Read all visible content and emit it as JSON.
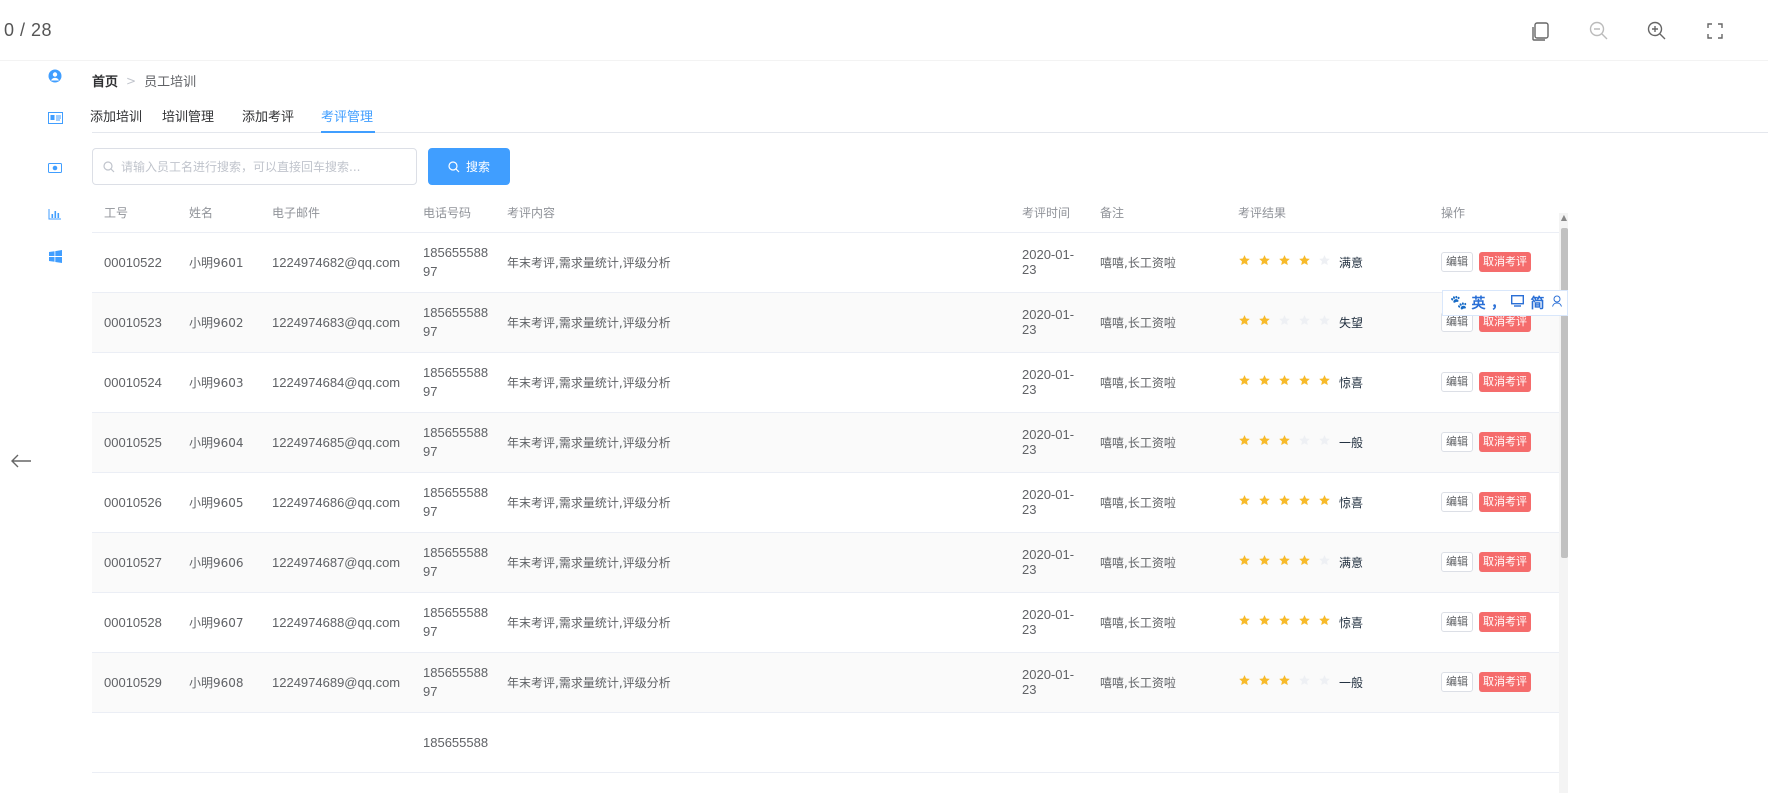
{
  "viewer": {
    "page_counter": "0 / 28",
    "tools": [
      "copy-icon",
      "zoom-out-icon",
      "zoom-in-icon",
      "fullscreen-icon"
    ]
  },
  "colors": {
    "primary": "#409eff",
    "danger": "#f56c6c",
    "star": "#f7ba2a",
    "star_off": "#eef0f4"
  },
  "breadcrumb": {
    "home": "首页",
    "separator": ">",
    "current": "员工培训"
  },
  "tabs": [
    {
      "label": "添加培训",
      "active": false
    },
    {
      "label": "培训管理",
      "active": false
    },
    {
      "label": "添加考评",
      "active": false
    },
    {
      "label": "考评管理",
      "active": true
    }
  ],
  "search": {
    "placeholder": "请输入员工名进行搜索，可以直接回车搜索...",
    "value": "",
    "button_label": "搜索"
  },
  "table": {
    "columns": [
      "工号",
      "姓名",
      "电子邮件",
      "电话号码",
      "考评内容",
      "考评时间",
      "备注",
      "考评结果",
      "操作"
    ],
    "edit_label": "编辑",
    "cancel_label": "取消考评",
    "rows": [
      {
        "id": "00010522",
        "name": "小明9601",
        "email": "1224974682@qq.com",
        "phone_line1": "185655588",
        "phone_line2": "97",
        "content": "年末考评,需求量统计,评级分析",
        "date": "2020-01-23",
        "remark": "嘻嘻,长工资啦",
        "rating": 4,
        "rating_text": "满意"
      },
      {
        "id": "00010523",
        "name": "小明9602",
        "email": "1224974683@qq.com",
        "phone_line1": "185655588",
        "phone_line2": "97",
        "content": "年末考评,需求量统计,评级分析",
        "date": "2020-01-23",
        "remark": "嘻嘻,长工资啦",
        "rating": 2,
        "rating_text": "失望"
      },
      {
        "id": "00010524",
        "name": "小明9603",
        "email": "1224974684@qq.com",
        "phone_line1": "185655588",
        "phone_line2": "97",
        "content": "年末考评,需求量统计,评级分析",
        "date": "2020-01-23",
        "remark": "嘻嘻,长工资啦",
        "rating": 5,
        "rating_text": "惊喜"
      },
      {
        "id": "00010525",
        "name": "小明9604",
        "email": "1224974685@qq.com",
        "phone_line1": "185655588",
        "phone_line2": "97",
        "content": "年末考评,需求量统计,评级分析",
        "date": "2020-01-23",
        "remark": "嘻嘻,长工资啦",
        "rating": 3,
        "rating_text": "一般"
      },
      {
        "id": "00010526",
        "name": "小明9605",
        "email": "1224974686@qq.com",
        "phone_line1": "185655588",
        "phone_line2": "97",
        "content": "年末考评,需求量统计,评级分析",
        "date": "2020-01-23",
        "remark": "嘻嘻,长工资啦",
        "rating": 5,
        "rating_text": "惊喜"
      },
      {
        "id": "00010527",
        "name": "小明9606",
        "email": "1224974687@qq.com",
        "phone_line1": "185655588",
        "phone_line2": "97",
        "content": "年末考评,需求量统计,评级分析",
        "date": "2020-01-23",
        "remark": "嘻嘻,长工资啦",
        "rating": 4,
        "rating_text": "满意"
      },
      {
        "id": "00010528",
        "name": "小明9607",
        "email": "1224974688@qq.com",
        "phone_line1": "185655588",
        "phone_line2": "97",
        "content": "年末考评,需求量统计,评级分析",
        "date": "2020-01-23",
        "remark": "嘻嘻,长工资啦",
        "rating": 5,
        "rating_text": "惊喜"
      },
      {
        "id": "00010529",
        "name": "小明9608",
        "email": "1224974689@qq.com",
        "phone_line1": "185655588",
        "phone_line2": "97",
        "content": "年末考评,需求量统计,评级分析",
        "date": "2020-01-23",
        "remark": "嘻嘻,长工资啦",
        "rating": 3,
        "rating_text": "一般"
      },
      {
        "id": "",
        "name": "",
        "email": "",
        "phone_line1": "185655588",
        "phone_line2": "",
        "content": "",
        "date": "",
        "remark": "",
        "rating": 0,
        "rating_text": ""
      }
    ]
  },
  "ime_toolbar": {
    "items": [
      "英",
      "，",
      "简"
    ]
  }
}
